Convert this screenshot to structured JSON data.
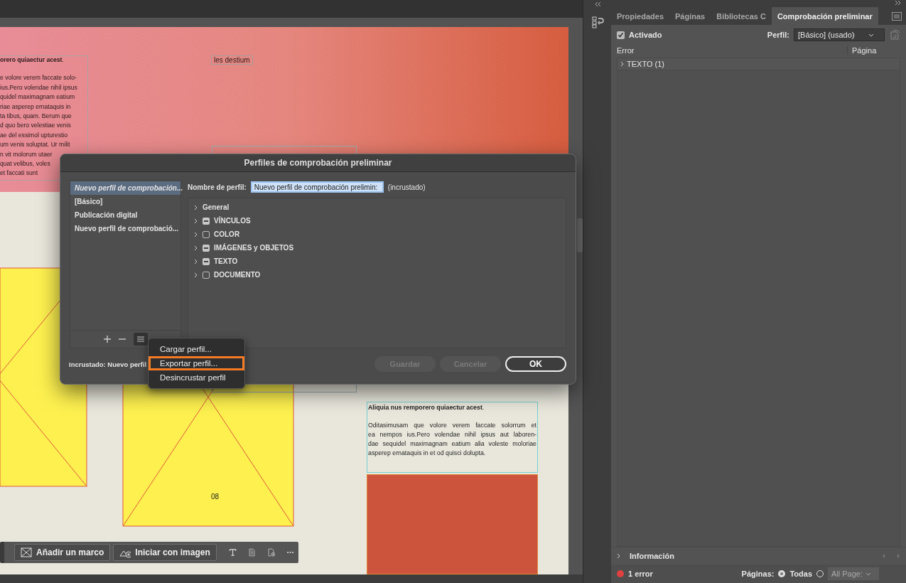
{
  "document": {
    "left_text": {
      "heading": "**orero quiaectur acest**.",
      "lines": [
        "e volore verem faccate solo-",
        "ius.Pero volendae nihil ipsus",
        "quidel maximagnam eatium",
        "riae asperep ernataquis in",
        "ta tibus, quam. Berum que",
        "d quo bero velestiae venis",
        "ae del essimol upturestio",
        "um venis soluptat. Ur milit",
        "n vit molorum utaer",
        "quat velibus, voles",
        "et faccati sunt"
      ]
    },
    "caption": "les destium",
    "page_number": "08",
    "right_text": {
      "heading": "**Aliquia nus remporero quiaectur acest**.",
      "lines": [
        "Oditasimusam que volore verem faccate solorrum et",
        "ea nempos ius.Pero volendae nihil ipsus aut laboren-",
        "dae sequidel maximagnam eatium alia voleste moloriae",
        "asperep ernataquis in et od quisci dolupta."
      ]
    }
  },
  "context_toolbar": {
    "buttons": [
      {
        "label": "Añadir un marco",
        "kind": "frame"
      },
      {
        "label": "Iniciar con imagen",
        "kind": "image"
      }
    ]
  },
  "dialog": {
    "title": "Perfiles de comprobación preliminar",
    "profiles": [
      {
        "label": "Nuevo perfil de comprobación...",
        "selected": true
      },
      {
        "label": "[Básico]",
        "selected": false
      },
      {
        "label": "Publicación digital",
        "selected": false
      },
      {
        "label": "Nuevo perfil de comprobació...",
        "selected": false
      }
    ],
    "name_label": "Nombre de perfil:",
    "name_value": "Nuevo perfil de comprobación prelimin:",
    "name_note": "(incrustado)",
    "categories": [
      {
        "label": "General",
        "kind": "plain",
        "expanded": false
      },
      {
        "label": "VÍNCULOS",
        "kind": "checkbox",
        "checked": true,
        "mixed": true,
        "expanded": false
      },
      {
        "label": "COLOR",
        "kind": "checkbox",
        "checked": false,
        "mixed": false,
        "expanded": false
      },
      {
        "label": "IMÁGENES y OBJETOS",
        "kind": "checkbox",
        "checked": true,
        "mixed": true,
        "expanded": false
      },
      {
        "label": "TEXTO",
        "kind": "checkbox",
        "checked": true,
        "mixed": true,
        "expanded": false
      },
      {
        "label": "DOCUMENTO",
        "kind": "checkbox",
        "checked": false,
        "mixed": false,
        "expanded": false
      }
    ],
    "embedded_label": "Incrustado: Nuevo perfil",
    "buttons": [
      {
        "label": "Guardar",
        "kind": "secondary",
        "disabled": true
      },
      {
        "label": "Cancelar",
        "kind": "secondary",
        "disabled": true
      },
      {
        "label": "OK",
        "kind": "primary",
        "disabled": false
      }
    ],
    "menu": [
      {
        "label": "Cargar perfil...",
        "highlighted": false
      },
      {
        "label": "Exportar perfil...",
        "highlighted": true
      },
      {
        "label": "Desincrustar perfil",
        "highlighted": false
      }
    ]
  },
  "panel": {
    "tabs": [
      {
        "label": "Propiedades",
        "selected": false
      },
      {
        "label": "Páginas",
        "selected": false
      },
      {
        "label": "Bibliotecas C",
        "selected": false
      },
      {
        "label": "Comprobación preliminar",
        "selected": true
      }
    ],
    "enabled": {
      "label": "Activado",
      "checked": true
    },
    "profile_label": "Perfil:",
    "profile_value": "[Básico] (usado)",
    "columns": [
      "Error",
      "Página"
    ],
    "errors": [
      {
        "label": "TEXTO (1)",
        "expanded": false
      }
    ],
    "info_label": "Información",
    "status": {
      "text": "1 error",
      "color": "#e04040"
    },
    "pages_label": "Páginas:",
    "page_options": [
      {
        "label": "Todas",
        "selected": true
      },
      {
        "selected": false
      }
    ],
    "page_range": "All Page:"
  }
}
